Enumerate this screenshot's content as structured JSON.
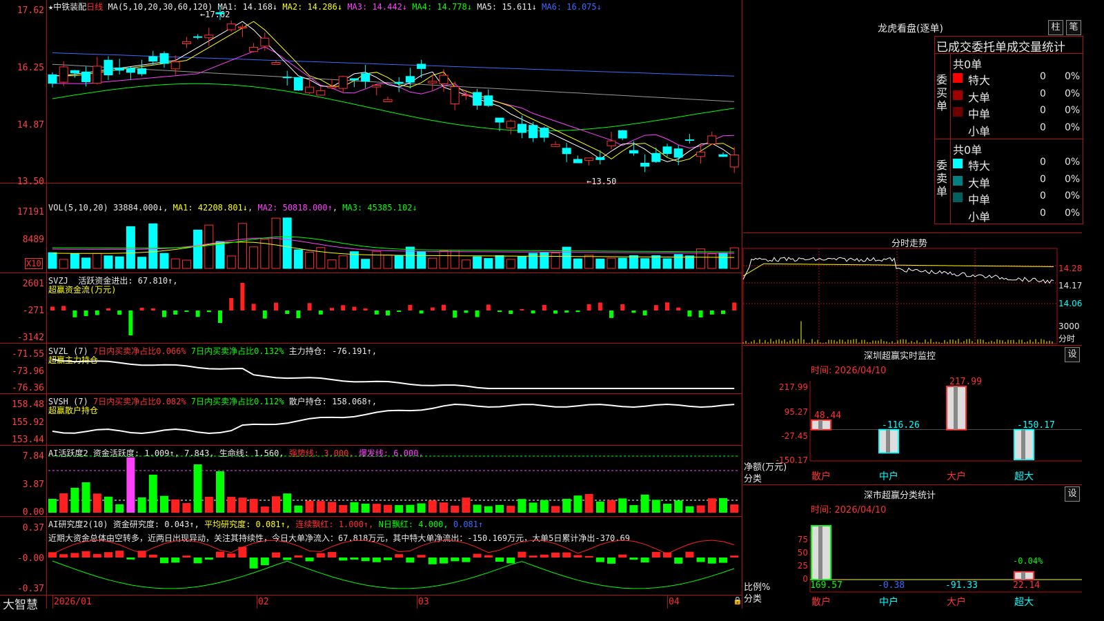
{
  "stock_name": "中铁装配",
  "period": "日线",
  "ma_header": {
    "params": "MA(5,10,20,30,60,120)",
    "ma1": "MA1: 14.168↓",
    "ma2": "MA2: 14.286↓",
    "ma3": "MA3: 14.442↓",
    "ma4": "MA4: 14.778↓",
    "ma5": "MA5: 15.611↓",
    "ma6": "MA6: 16.075↓"
  },
  "price_axis": [
    "17.62",
    "16.25",
    "14.87",
    "13.50"
  ],
  "price_hi_note": "17.62",
  "price_lo_note": "13.50",
  "vol_header": {
    "params": "VOL(5,10,20)",
    "vol": "33884.000↓",
    "ma1": "MA1: 42208.801↓",
    "ma2": "MA2: 50818.000↑",
    "ma3": "MA3: 45385.102↓"
  },
  "vol_axis": [
    "17191",
    "8489"
  ],
  "vol_unit": "X10",
  "svzj": {
    "title": "SVZJ",
    "desc": "活跃资金进出: 67.810↑,",
    "sub": "超赢资金流(万元)",
    "axis": [
      "2601",
      "-271",
      "-3142"
    ]
  },
  "svzl": {
    "title": "SVZL (7)",
    "a": "7日内买卖净占比0.066%",
    "b": "7日内买卖净占比0.132%",
    "c": "主力持仓: -76.191↑,",
    "sub": "超赢主力持仓",
    "axis": [
      "-71.55",
      "-73.96",
      "-76.36"
    ]
  },
  "svsh": {
    "title": "SVSH (7)",
    "a": "7日内买卖净占比0.082%",
    "b": "7日内买卖净占比0.112%",
    "c": "散户持仓: 158.068↑,",
    "sub": "超赢散户持仓",
    "axis": [
      "158.48",
      "155.92",
      "153.44"
    ]
  },
  "ai1": {
    "title": "AI活跃度2",
    "a": "资金活跃度: 1.009↑, 7.843,",
    "b": "生命线: 1.560,",
    "c": "强势线: 3.000,",
    "d": "爆发线: 6.000,",
    "axis": [
      "7.84",
      "3.87",
      "0.00"
    ]
  },
  "ai2": {
    "title": "AI研究度2(10)",
    "a": "资金研究度: 0.043↑,",
    "b": "平均研究度: 0.081↑,",
    "c": "连续飘红: 1.000↑,",
    "d": "N日飘红: 4.000,",
    "e": "0.081↑",
    "axis": [
      "0.37",
      "-0.00",
      "-0.37"
    ]
  },
  "summary_text": "近期大资金总体由空转多，近两日出现异动，关注其持续性，今日大单净流入：67.818万元，其中特大单净流出：-150.169万元，大单5日累计净出-370.69",
  "x_axis": [
    "2026/01",
    "02",
    "03",
    "04"
  ],
  "brand": "大智慧",
  "right": {
    "dragon_title": "龙虎看盘(逐单)",
    "btn_col": "柱",
    "btn_note": "笔",
    "tabs": [
      "已成交委托单成交量统计"
    ],
    "buy_label": "委买单",
    "sell_label": "委卖单",
    "buy_total": "共0单",
    "sell_total": "共0单",
    "buy_rows": [
      {
        "name": "特大",
        "count": "0",
        "pct": "0%",
        "color": "#ff0000"
      },
      {
        "name": "大单",
        "count": "0",
        "pct": "0%",
        "color": "#a00000"
      },
      {
        "name": "中单",
        "count": "0",
        "pct": "0%",
        "color": "#700000"
      },
      {
        "name": "小单",
        "count": "0",
        "pct": "0%",
        "color": "#000000"
      }
    ],
    "sell_rows": [
      {
        "name": "特大",
        "count": "0",
        "pct": "0%",
        "color": "#00ffff"
      },
      {
        "name": "大单",
        "count": "0",
        "pct": "0%",
        "color": "#008080"
      },
      {
        "name": "中单",
        "count": "0",
        "pct": "0%",
        "color": "#006060"
      },
      {
        "name": "小单",
        "count": "0",
        "pct": "0%",
        "color": "#000000"
      }
    ],
    "fenshi_title": "分时走势",
    "fenshi_axis": [
      "14.28",
      "14.17",
      "14.06"
    ],
    "fenshi_vol": "3000",
    "fenshi_unit": "分时",
    "monitor_title": "深圳超赢实时监控",
    "monitor_set": "设",
    "monitor_time": "时间: 2026/04/10",
    "monitor_axis": [
      "217.99",
      "95.27",
      "-27.45",
      "-150.17"
    ],
    "monitor_ylabel": "净额(万元)",
    "monitor_xlabel": "分类",
    "classify_title": "深市超赢分类统计",
    "classify_set": "设",
    "classify_time": "时间: 2026/04/10",
    "classify_axis": [
      "75",
      "50",
      "25",
      "0"
    ],
    "classify_ylabel": "比例%",
    "classify_xlabel": "分类",
    "categories": [
      "散户",
      "中户",
      "大户",
      "超大"
    ]
  },
  "chart_data": [
    {
      "type": "bar",
      "title": "深圳超赢实时监控",
      "ylabel": "净额(万元)",
      "xlabel": "分类",
      "categories": [
        "散户",
        "中户",
        "大户",
        "超大"
      ],
      "values": [
        48.44,
        -116.26,
        217.99,
        -150.17
      ],
      "ylim": [
        -150.17,
        217.99
      ]
    },
    {
      "type": "bar",
      "title": "深市超赢分类统计",
      "ylabel": "比例%",
      "xlabel": "分类",
      "categories": [
        "散户",
        "中户",
        "大户",
        "超大"
      ],
      "values": [
        169.57,
        -0.38,
        -91.33,
        22.14
      ],
      "ylim": [
        0,
        75
      ],
      "annotations": [
        "-0.04%"
      ]
    }
  ]
}
